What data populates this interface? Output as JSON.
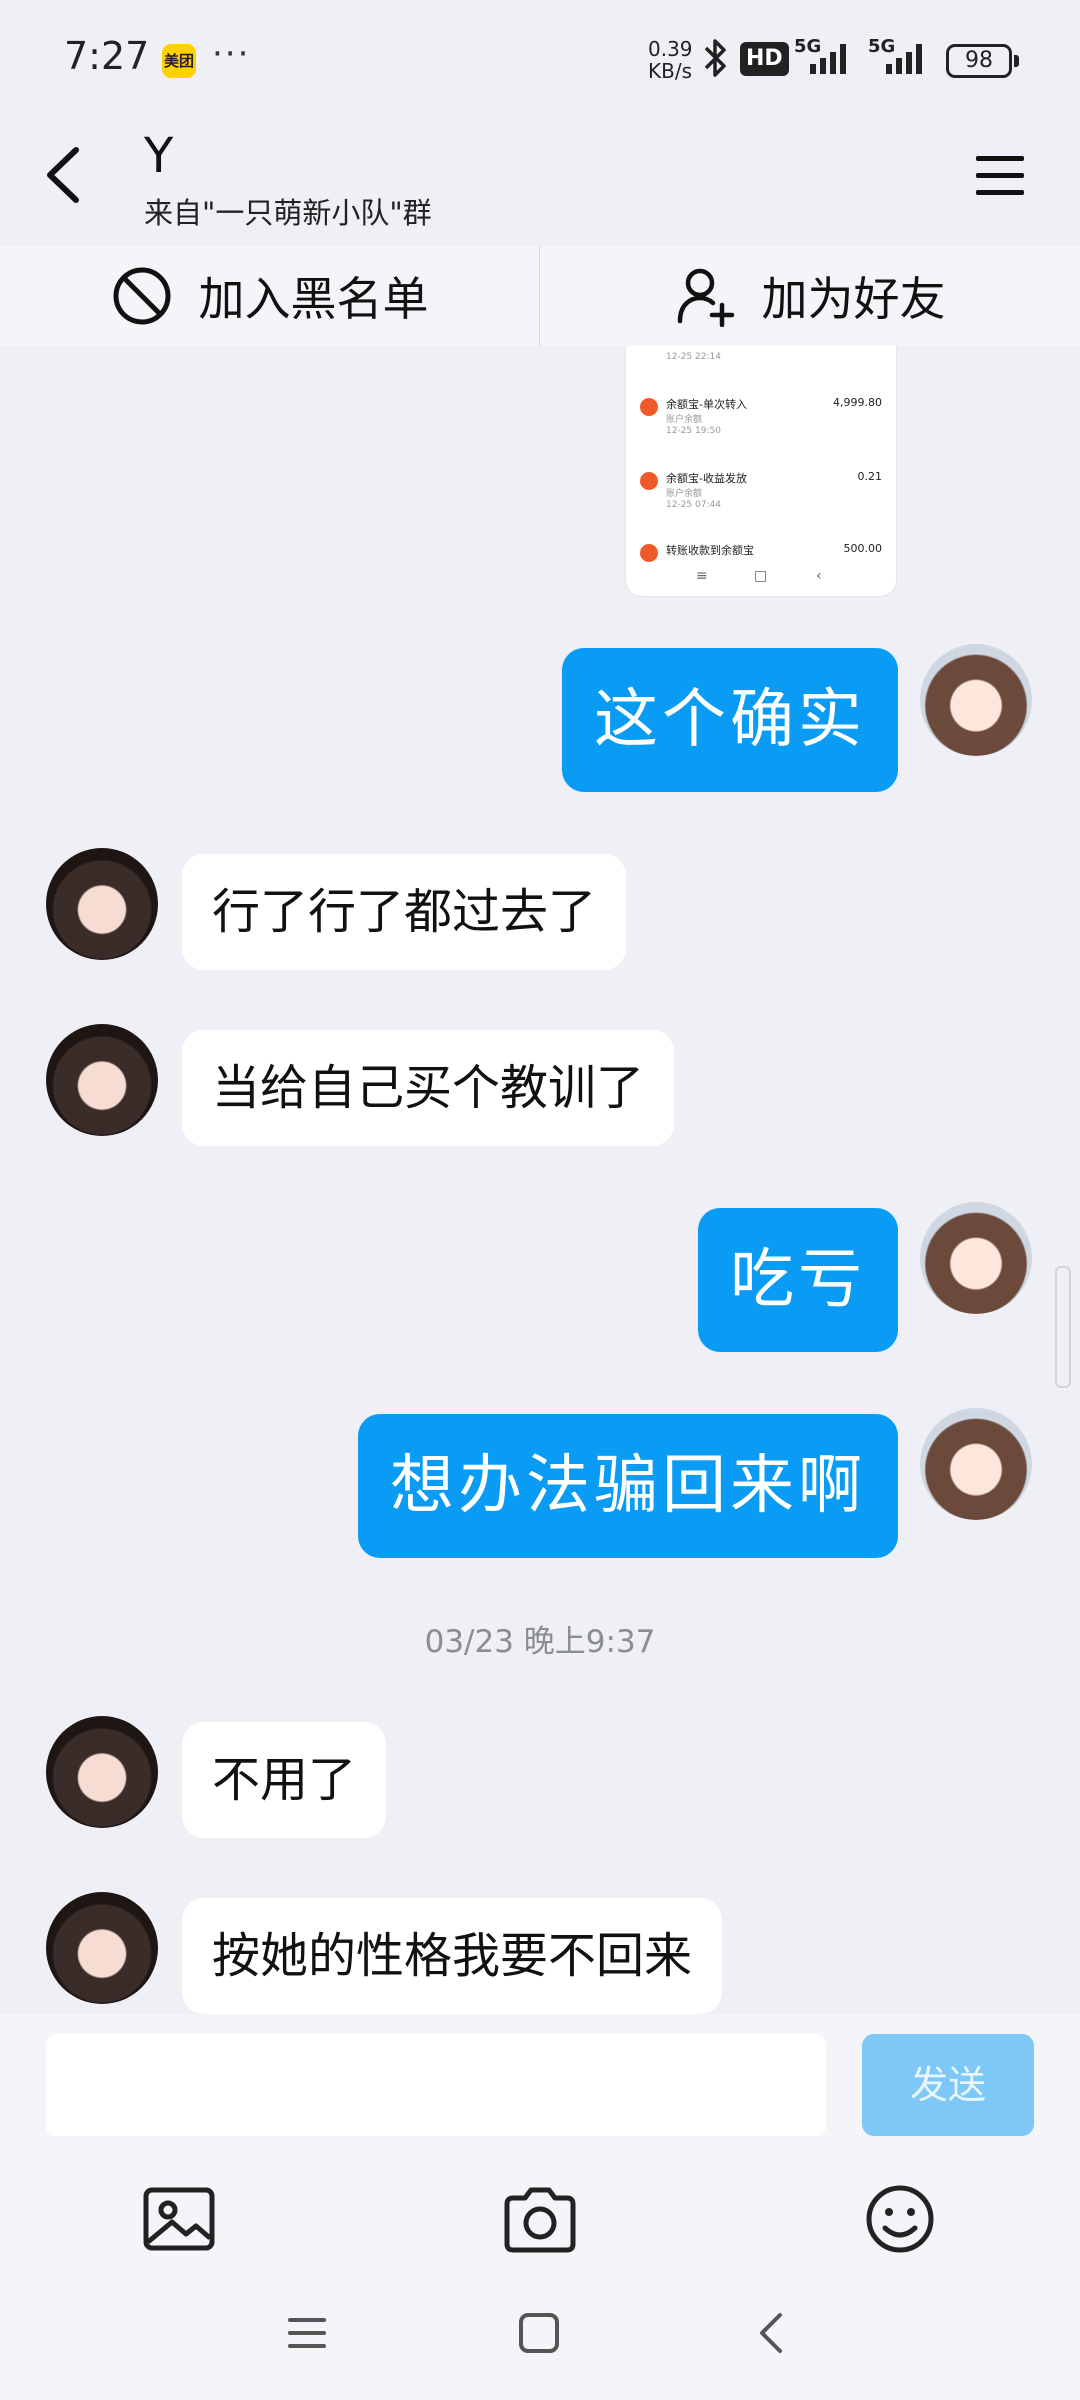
{
  "status_bar": {
    "time": "7:27",
    "app_badge": "美团",
    "more": "···",
    "net_speed_value": "0.39",
    "net_speed_unit": "KB/s",
    "hd_label": "HD",
    "sim1_label": "5G",
    "sim2_label": "5G",
    "battery": "98"
  },
  "header": {
    "title": "Y",
    "subtitle": "来自\"一只萌新小队\"群",
    "back_icon": "chevron-left-icon",
    "menu_icon": "hamburger-menu-icon"
  },
  "actions": {
    "block_label": "加入黑名单",
    "add_friend_label": "加为好友"
  },
  "shared_image": {
    "rows": [
      {
        "title": "",
        "sub": "",
        "time": "12-25 22:14",
        "amount": ""
      },
      {
        "title": "余额宝-单次转入",
        "sub": "账户余额",
        "time": "12-25 19:50",
        "amount": "4,999.80"
      },
      {
        "title": "余额宝-收益发放",
        "sub": "账户余额",
        "time": "12-25 07:44",
        "amount": "0.21"
      },
      {
        "title": "转账收款到余额宝",
        "sub": "",
        "time": "",
        "amount": "500.00"
      }
    ]
  },
  "messages": [
    {
      "side": "out",
      "text": "这个确实"
    },
    {
      "side": "in",
      "text": "行了行了都过去了"
    },
    {
      "side": "in",
      "text": "当给自己买个教训了"
    },
    {
      "side": "out",
      "text": "吃亏"
    },
    {
      "side": "out",
      "text": "想办法骗回来啊"
    },
    {
      "side": "time",
      "text": "03/23 晚上9:37"
    },
    {
      "side": "in",
      "text": "不用了"
    },
    {
      "side": "in",
      "text": "按她的性格我要不回来"
    }
  ],
  "input": {
    "value": "",
    "send_label": "发送"
  },
  "toolbar": [
    "image-icon",
    "camera-icon",
    "emoji-icon"
  ],
  "system_nav": [
    "menu-icon",
    "home-icon",
    "back-icon"
  ],
  "colors": {
    "outgoing_bubble": "#0a9cf5",
    "incoming_bubble": "#ffffff",
    "background": "#eff0f5",
    "send_button": "#7dc8f6"
  }
}
